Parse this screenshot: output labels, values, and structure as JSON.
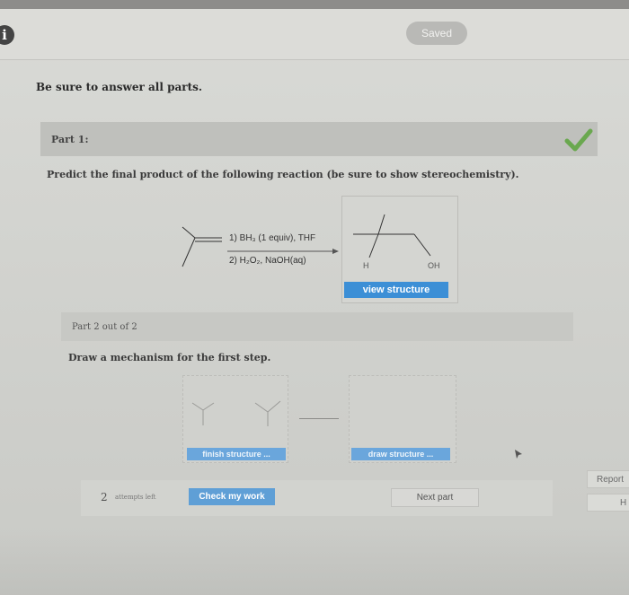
{
  "header": {
    "info_icon": "info-icon",
    "info_glyph": "i",
    "saved_label": "Saved"
  },
  "instructions": "Be sure to answer all parts.",
  "part1": {
    "label": "Part 1:",
    "status_icon": "checkmark-icon",
    "status_color": "#6aa84f",
    "question": "Predict the final product of the following reaction (be sure to show stereochemistry).",
    "reagents": {
      "step1": "1) BH₃ (1 equiv), THF",
      "step2": "2) H₂O₂, NaOH(aq)"
    },
    "product_labels": {
      "h": "H",
      "oh": "OH"
    },
    "view_structure_label": "view structure"
  },
  "part2": {
    "label": "Part 2 out of 2",
    "question": "Draw a mechanism for the first step.",
    "finish_structure_label": "finish structure ...",
    "draw_structure_label": "draw structure ..."
  },
  "footer": {
    "attempts_count": "2",
    "attempts_text": "attempts left",
    "check_label": "Check my work",
    "next_label": "Next part",
    "report_label": "Report",
    "help_label": "H"
  },
  "colors": {
    "accent_blue": "#3c8fd6",
    "success_green": "#6aa84f"
  }
}
